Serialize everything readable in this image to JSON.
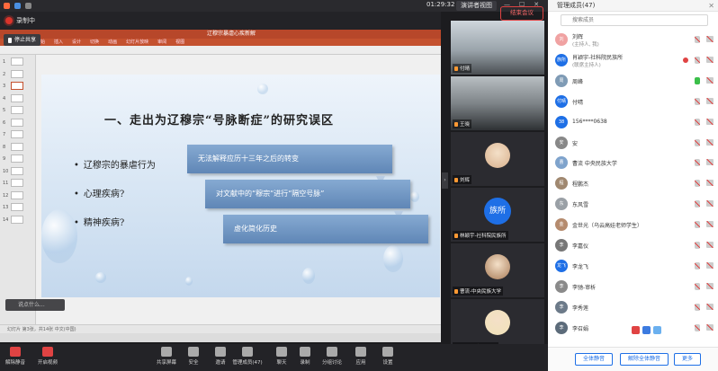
{
  "topbar": {
    "time": "01:29:32",
    "view_mode": "演讲者视图"
  },
  "recording": {
    "label": "录制中"
  },
  "share": {
    "stop_share": "停止共享",
    "ppt_title": "辽穆宗暴虐心疾新解",
    "ppt_ribbon": [
      "开始",
      "插入",
      "设计",
      "切换",
      "动画",
      "幻灯片放映",
      "审阅",
      "视图"
    ],
    "status": "幻灯片 第3张，共14张   中文(中国)",
    "chat_hint": "说点什么..."
  },
  "thumbs": [
    "1",
    "2",
    "3",
    "4",
    "5",
    "6",
    "7",
    "8",
    "9",
    "10",
    "11",
    "12",
    "13",
    "14"
  ],
  "slide": {
    "title": "一、走出为辽穆宗“号脉断症”的研究误区",
    "bullets": [
      "辽穆宗的暴虐行为",
      "心理疾病?",
      "精神疾病?"
    ],
    "boxes": [
      "无法解释应历十三年之后的转变",
      "对文献中的“穆宗”进行“隔空号脉”",
      "虚化简化历史"
    ]
  },
  "videos": [
    {
      "name": "付晴",
      "type": "photo-a"
    },
    {
      "name": "王晓",
      "type": "photo-b"
    },
    {
      "name": "刘辉",
      "type": "avatar"
    },
    {
      "name": "林颖宇-社科院民族所",
      "type": "text",
      "text": "族所"
    },
    {
      "name": "曹流-中央民族大学",
      "type": "avatar2"
    },
    {
      "name": "吴博宇-首师大学",
      "type": "avatar3"
    }
  ],
  "panel": {
    "title": "管理成员(47)",
    "search_placeholder": "搜索成员",
    "members": [
      {
        "name": "刘辉",
        "role": "(主持人, 我)",
        "avatar": "刘"
      },
      {
        "name": "肖颖宇-社科院民族所",
        "role": "(联席主持人)",
        "avatar": "族所"
      },
      {
        "name": "周峰",
        "role": "",
        "avatar": "周"
      },
      {
        "name": "付晴",
        "role": "",
        "avatar": "付晴"
      },
      {
        "name": "156****0638",
        "role": "",
        "avatar": "38"
      },
      {
        "name": "安",
        "role": "",
        "avatar": "安"
      },
      {
        "name": "曹流 中央民族大学",
        "role": "",
        "avatar": "曹"
      },
      {
        "name": "程鹏杰",
        "role": "",
        "avatar": "程"
      },
      {
        "name": "东风雪",
        "role": "",
        "avatar": "东"
      },
      {
        "name": "金世光（乌云高娃老师学生）",
        "role": "",
        "avatar": "金"
      },
      {
        "name": "李嘉仪",
        "role": "",
        "avatar": "李"
      },
      {
        "name": "李龙飞",
        "role": "",
        "avatar": "龙飞"
      },
      {
        "name": "李驰-审析",
        "role": "",
        "avatar": "李"
      },
      {
        "name": "李秀莲",
        "role": "",
        "avatar": "李"
      },
      {
        "name": "李召娟",
        "role": "",
        "avatar": "李"
      }
    ],
    "mute_all": "全体静音",
    "unmute_all": "解除全体静音",
    "more": "更多"
  },
  "toolbar": {
    "buttons": [
      "解除静音",
      "开启视频",
      "共享屏幕",
      "安全",
      "邀请",
      "管理成员(47)",
      "聊天",
      "录制",
      "分组讨论",
      "应用",
      "设置"
    ],
    "end": "结束会议"
  },
  "colors": {
    "accent": "#1e6fe6",
    "danger": "#e04343",
    "ppt": "#b7472a"
  }
}
